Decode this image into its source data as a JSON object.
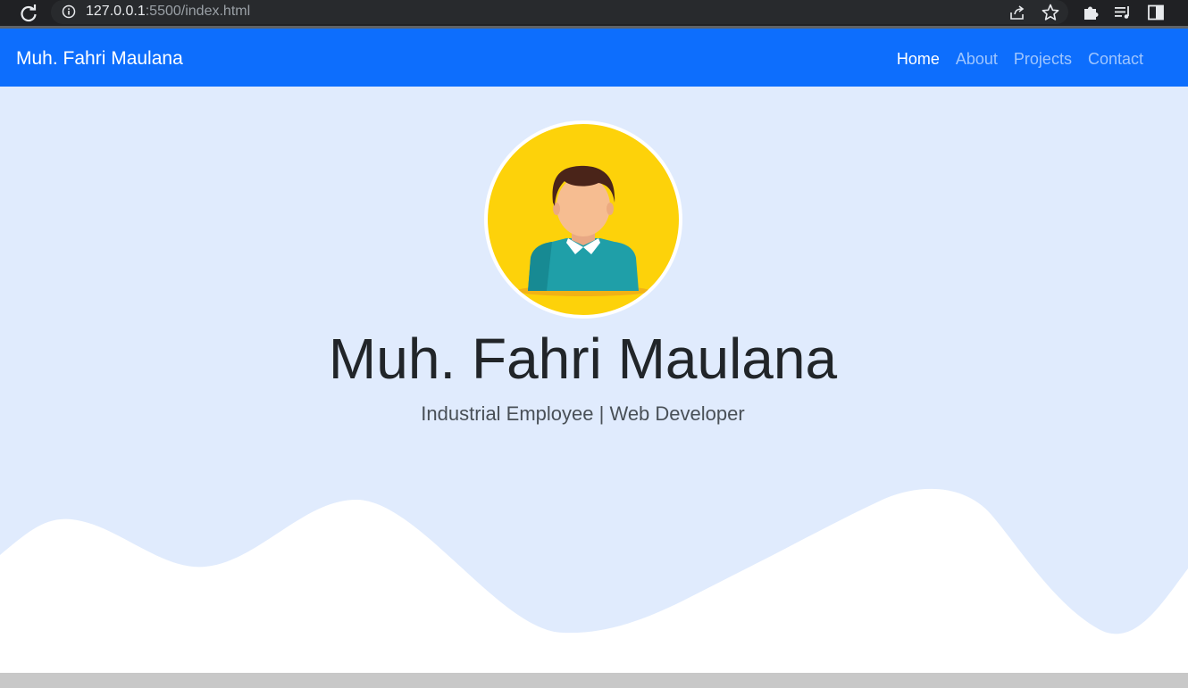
{
  "browser": {
    "url_host": "127.0.0.1",
    "url_rest": ":5500/index.html"
  },
  "navbar": {
    "brand": "Muh. Fahri Maulana",
    "links": [
      {
        "label": "Home",
        "active": true
      },
      {
        "label": "About",
        "active": false
      },
      {
        "label": "Projects",
        "active": false
      },
      {
        "label": "Contact",
        "active": false
      }
    ]
  },
  "hero": {
    "name": "Muh. Fahri Maulana",
    "subtitle": "Industrial Employee | Web Developer"
  },
  "colors": {
    "navbar": "#0d6efd",
    "hero_bg": "#e0ebfd",
    "avatar_bg": "#fdd20a"
  }
}
